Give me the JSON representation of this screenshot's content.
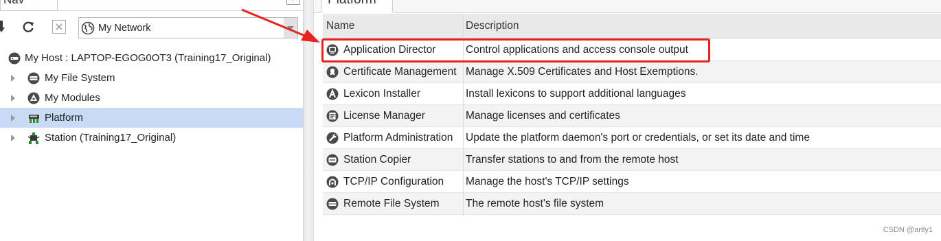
{
  "nav": {
    "tab_label": "Nav",
    "network_select": "My Network",
    "tree": [
      {
        "label": "My Host : LAPTOP-EGOG0OT3 (Training17_Original)",
        "icon": "host-icon"
      },
      {
        "label": "My File System",
        "icon": "file-system-icon"
      },
      {
        "label": "My Modules",
        "icon": "modules-icon"
      },
      {
        "label": "Platform",
        "icon": "platform-icon",
        "selected": true
      },
      {
        "label": "Station (Training17_Original)",
        "icon": "station-icon"
      }
    ]
  },
  "platform": {
    "tab_label": "Platform",
    "columns": {
      "name": "Name",
      "description": "Description"
    },
    "rows": [
      {
        "name": "Application Director",
        "description": "Control applications and access console output",
        "icon": "app-director-icon"
      },
      {
        "name": "Certificate Management",
        "description": "Manage X.509 Certificates and Host Exemptions.",
        "icon": "certificate-icon"
      },
      {
        "name": "Lexicon Installer",
        "description": "Install lexicons to support additional languages",
        "icon": "lexicon-icon"
      },
      {
        "name": "License Manager",
        "description": "Manage licenses and certificates",
        "icon": "license-icon"
      },
      {
        "name": "Platform Administration",
        "description": "Update the platform daemon's port or credentials, or set its date and time",
        "icon": "platform-admin-icon"
      },
      {
        "name": "Station Copier",
        "description": "Transfer stations to and from the remote host",
        "icon": "station-copier-icon"
      },
      {
        "name": "TCP/IP Configuration",
        "description": "Manage the host's TCP/IP settings",
        "icon": "tcpip-icon"
      },
      {
        "name": "Remote File System",
        "description": "The remote host's file system",
        "icon": "remote-fs-icon"
      }
    ]
  },
  "annotation_color": "#e8231e",
  "selection_color": "#c8daf4",
  "watermark": "CSDN @artly1"
}
